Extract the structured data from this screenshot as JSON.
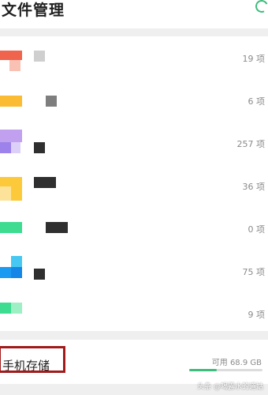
{
  "header": {
    "title": "文件管理",
    "refresh_icon": "refresh-icon",
    "accent": "#3dbd7b"
  },
  "categories": [
    {
      "icon": "red-category-icon",
      "count": "19 项"
    },
    {
      "icon": "orange-category-icon",
      "count": "6 项"
    },
    {
      "icon": "purple-category-icon",
      "count": "257 项"
    },
    {
      "icon": "yellow-category-icon",
      "count": "36 项"
    },
    {
      "icon": "green-category-icon",
      "count": "0 项"
    },
    {
      "icon": "blue-category-icon",
      "count": "75 项"
    },
    {
      "icon": "mint-category-icon",
      "count": "9 项"
    }
  ],
  "storage": {
    "label": "手机存储",
    "available": "可用 68.9 GB",
    "used_fraction": 0.38
  },
  "watermark": "头条 @喝露水的道姑"
}
